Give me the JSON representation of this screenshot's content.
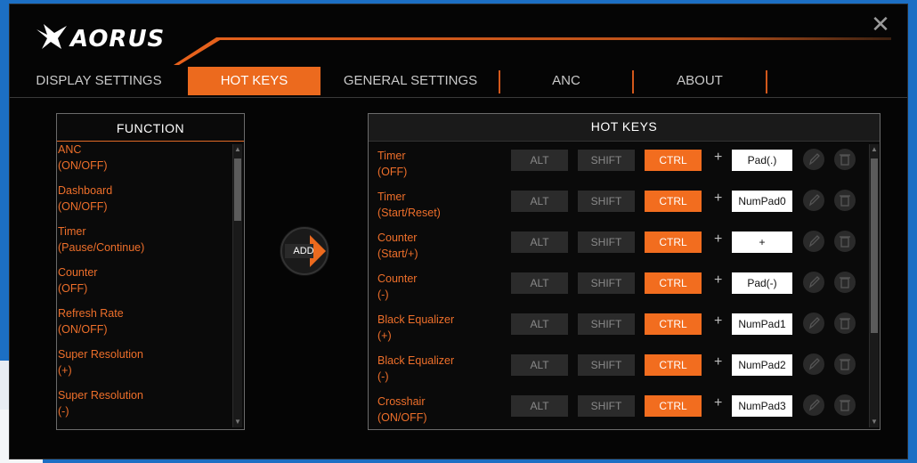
{
  "app": {
    "brand": "AORUS",
    "close_glyph": "✕"
  },
  "tabs": [
    {
      "label": "DISPLAY SETTINGS",
      "active": false
    },
    {
      "label": "HOT KEYS",
      "active": true
    },
    {
      "label": "GENERAL SETTINGS",
      "active": false
    },
    {
      "label": "ANC",
      "active": false
    },
    {
      "label": "ABOUT",
      "active": false
    }
  ],
  "function_panel": {
    "title": "FUNCTION",
    "items": [
      {
        "line1": "ANC",
        "line2": "(ON/OFF)"
      },
      {
        "line1": "Dashboard",
        "line2": "(ON/OFF)"
      },
      {
        "line1": "Timer",
        "line2": "(Pause/Continue)"
      },
      {
        "line1": "Counter",
        "line2": "(OFF)"
      },
      {
        "line1": "Refresh Rate",
        "line2": "(ON/OFF)"
      },
      {
        "line1": "Super Resolution",
        "line2": "(+)"
      },
      {
        "line1": "Super Resolution",
        "line2": "(-)"
      }
    ]
  },
  "add_button": {
    "label": "ADD"
  },
  "hotkeys_panel": {
    "title": "HOT KEYS",
    "modifier_labels": {
      "alt": "ALT",
      "shift": "SHIFT",
      "ctrl": "CTRL"
    },
    "plus": "+",
    "rows": [
      {
        "line1": "Timer",
        "line2": "(OFF)",
        "key": "Pad(.)"
      },
      {
        "line1": "Timer",
        "line2": "(Start/Reset)",
        "key": "NumPad0"
      },
      {
        "line1": "Counter",
        "line2": "(Start/+)",
        "key": "+"
      },
      {
        "line1": "Counter",
        "line2": "(-)",
        "key": "Pad(-)"
      },
      {
        "line1": "Black Equalizer",
        "line2": "(+)",
        "key": "NumPad1"
      },
      {
        "line1": "Black Equalizer",
        "line2": "(-)",
        "key": "NumPad2"
      },
      {
        "line1": "Crosshair",
        "line2": "(ON/OFF)",
        "key": "NumPad3"
      }
    ]
  },
  "colors": {
    "accent": "#EC6A1E",
    "background": "#050505",
    "desktop": "#1C6FC4"
  }
}
